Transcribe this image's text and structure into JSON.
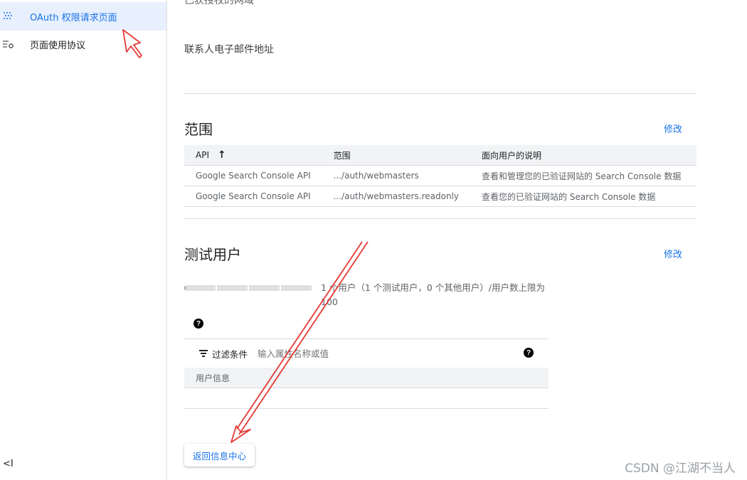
{
  "sidebar": {
    "items": [
      {
        "label": "OAuth 权限请求页面",
        "icon": "dots-grid-icon",
        "active": true
      },
      {
        "label": "页面使用协议",
        "icon": "list-settings-icon",
        "active": false
      }
    ],
    "collapse_icon": "<I"
  },
  "main": {
    "partial_text": "已获授权的网域",
    "contact_label": "联系人电子邮件地址",
    "scopes": {
      "title": "范围",
      "edit_label": "修改",
      "columns": [
        "API",
        "范围",
        "面向用户的说明"
      ],
      "sort_arrow": "↑",
      "rows": [
        [
          "Google Search Console API",
          ".../auth/webmasters",
          "查看和管理您的已验证网站的 Search Console 数据"
        ],
        [
          "Google Search Console API",
          ".../auth/webmasters.readonly",
          "查看您的已验证网站的 Search Console 数据"
        ]
      ]
    },
    "test_users": {
      "title": "测试用户",
      "edit_label": "修改",
      "usage_fraction": 0.01,
      "usage_text": "1 个用户（1 个测试用户，0 个其他用户）/用户数上限为 100",
      "help_symbol": "?",
      "filter_label": "过滤条件",
      "filter_placeholder": "输入属性名称或值",
      "column_header": "用户信息"
    },
    "back_button": "返回信息中心"
  },
  "watermark": "CSDN @江湖不当人",
  "colors": {
    "accent": "#1a73e8",
    "annotation": "#e53935"
  }
}
